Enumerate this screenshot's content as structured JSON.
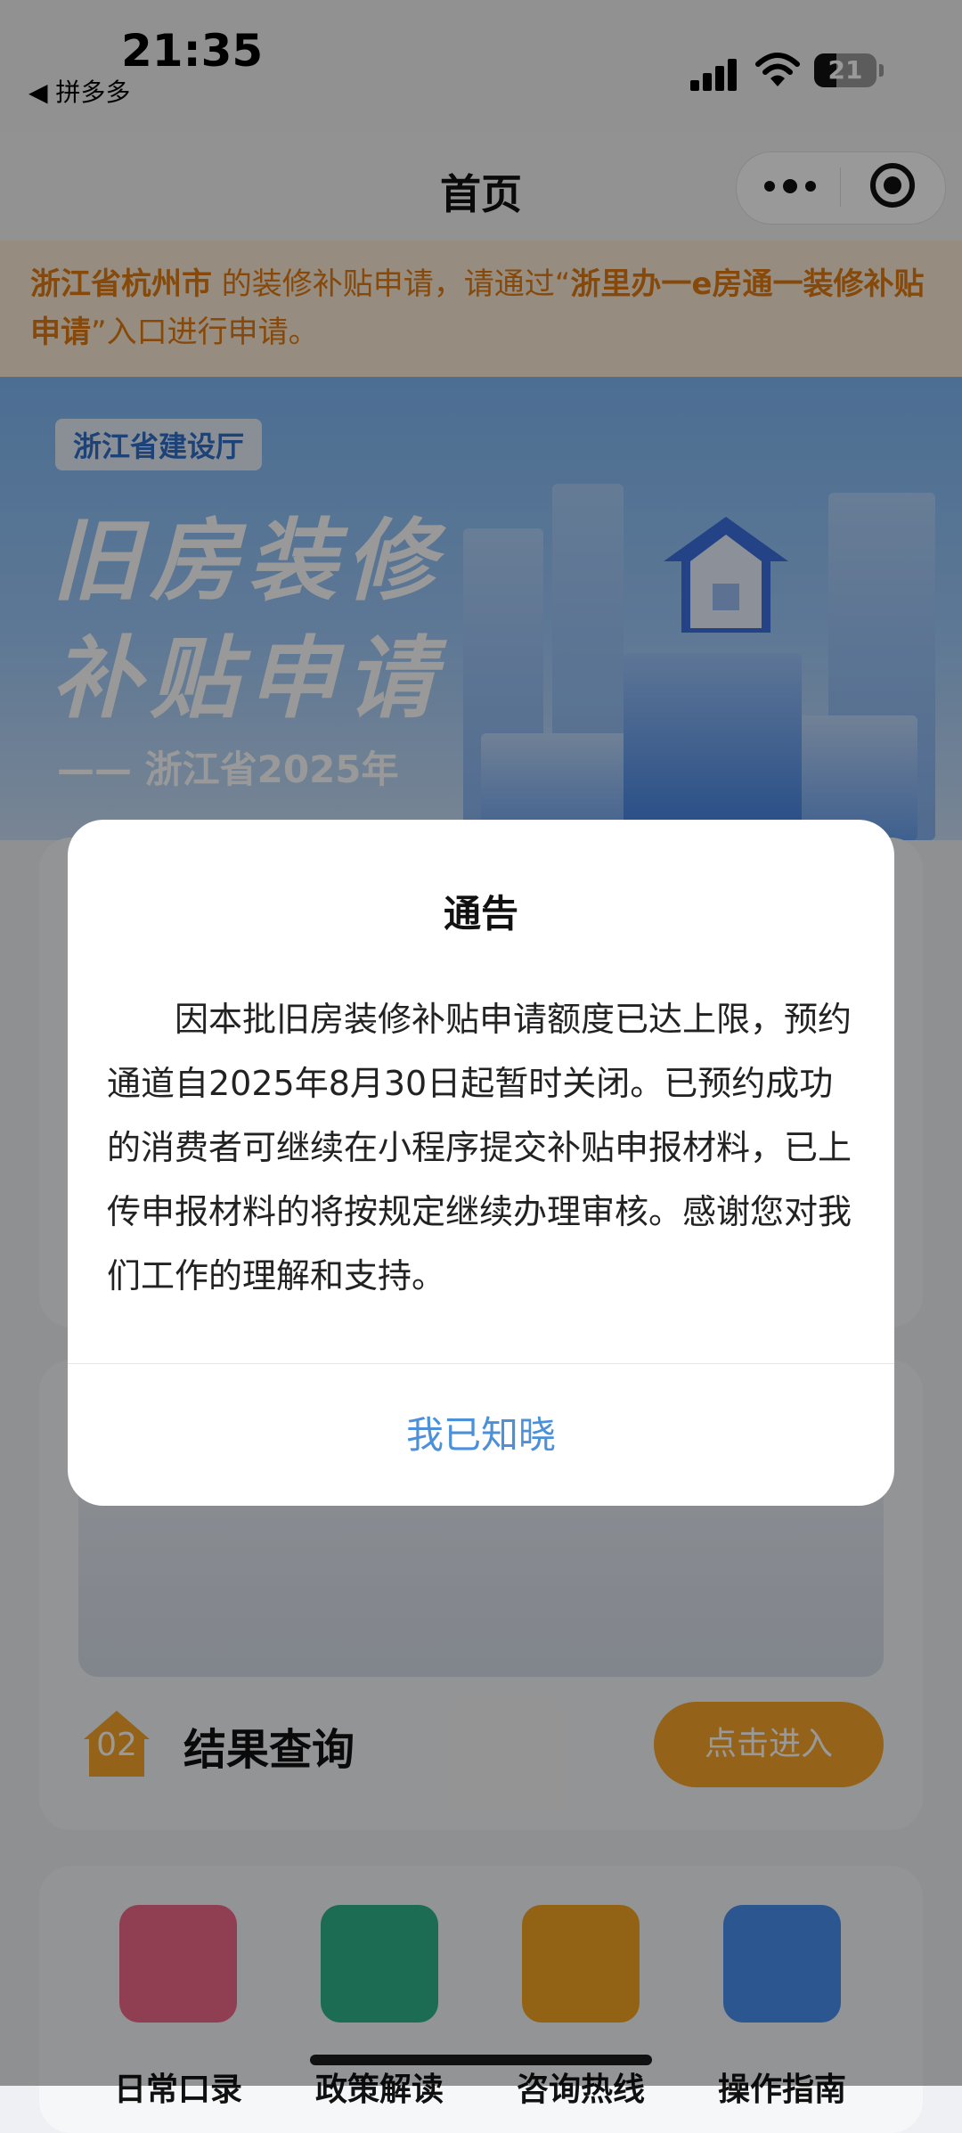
{
  "status_bar": {
    "time": "21:35",
    "back_app": "◀ 拼多多",
    "battery": "21"
  },
  "nav": {
    "title": "首页"
  },
  "notice": {
    "region": "浙江省杭州市",
    "text_mid": " 的装修补贴申请，请通过“",
    "entry": "浙里办一e房通一装修补贴申请",
    "text_end": "”入口进行申请。"
  },
  "banner": {
    "tag": "浙江省建设厅",
    "title_line1": "旧房装修",
    "title_line2": "补贴申请",
    "subtitle": "—— 浙江省2025年"
  },
  "result_card": {
    "badge_num": "02",
    "title": "结果查询",
    "enter_label": "点击进入"
  },
  "shortcuts": [
    {
      "label": "日常口录",
      "icon": "calendar-icon",
      "color": "#f06a8a"
    },
    {
      "label": "政策解读",
      "icon": "policy-doc-icon",
      "color": "#2fb48a"
    },
    {
      "label": "咨询热线",
      "icon": "phone-icon",
      "color": "#f5a623"
    },
    {
      "label": "操作指南",
      "icon": "guide-doc-icon",
      "color": "#4a8ff0"
    }
  ],
  "modal": {
    "title": "通告",
    "body": "因本批旧房装修补贴申请额度已达上限，预约通道自2025年8月30日起暂时关闭。已预约成功的消费者可继续在小程序提交补贴申报材料，已上传申报材料的将按规定继续办理审核。感谢您对我们工作的理解和支持。",
    "confirm": "我已知晓"
  },
  "colors": {
    "notice_text": "#e07a10",
    "accent_orange": "#f7a42a",
    "modal_button": "#4c90d9"
  }
}
